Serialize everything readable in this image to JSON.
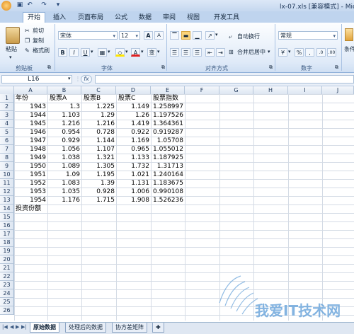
{
  "window": {
    "title": "lx-07.xls [兼容模式] - Microso"
  },
  "ribbon_tabs": [
    "开始",
    "插入",
    "页面布局",
    "公式",
    "数据",
    "审阅",
    "视图",
    "开发工具"
  ],
  "clipboard": {
    "paste": "粘贴",
    "cut": "剪切",
    "copy": "复制",
    "format_painter": "格式刷",
    "group": "剪贴板"
  },
  "font": {
    "name": "宋体",
    "size": "12",
    "grow": "A",
    "shrink": "A",
    "bold": "B",
    "italic": "I",
    "underline": "U",
    "font_color": "A",
    "phonetic": "变",
    "group": "字体"
  },
  "alignment": {
    "wrap": "自动换行",
    "merge": "合并后居中",
    "group": "对齐方式"
  },
  "number": {
    "format": "常规",
    "percent": "%",
    "comma": ",",
    "group": "数字"
  },
  "styles": {
    "label": "条件"
  },
  "formula_bar": {
    "name_box": "L16",
    "fx": "fx",
    "value": ""
  },
  "columns": [
    "A",
    "B",
    "C",
    "D",
    "E",
    "F",
    "G",
    "H",
    "I",
    "J"
  ],
  "rows": [
    "1",
    "2",
    "3",
    "4",
    "5",
    "6",
    "7",
    "8",
    "9",
    "10",
    "11",
    "12",
    "13",
    "14",
    "15",
    "16",
    "17",
    "18",
    "19",
    "20",
    "21",
    "22",
    "23",
    "24",
    "25",
    "26"
  ],
  "table": {
    "headers": [
      "年份",
      "股票A",
      "股票B",
      "股票C",
      "股票指数"
    ],
    "data": [
      [
        "1943",
        "1.3",
        "1.225",
        "1.149",
        "1.258997"
      ],
      [
        "1944",
        "1.103",
        "1.29",
        "1.26",
        "1.197526"
      ],
      [
        "1945",
        "1.216",
        "1.216",
        "1.419",
        "1.364361"
      ],
      [
        "1946",
        "0.954",
        "0.728",
        "0.922",
        "0.919287"
      ],
      [
        "1947",
        "0.929",
        "1.144",
        "1.169",
        "1.05708"
      ],
      [
        "1948",
        "1.056",
        "1.107",
        "0.965",
        "1.055012"
      ],
      [
        "1949",
        "1.038",
        "1.321",
        "1.133",
        "1.187925"
      ],
      [
        "1950",
        "1.089",
        "1.305",
        "1.732",
        "1.31713"
      ],
      [
        "1951",
        "1.09",
        "1.195",
        "1.021",
        "1.240164"
      ],
      [
        "1952",
        "1.083",
        "1.39",
        "1.131",
        "1.183675"
      ],
      [
        "1953",
        "1.035",
        "0.928",
        "1.006",
        "0.990108"
      ],
      [
        "1954",
        "1.176",
        "1.715",
        "1.908",
        "1.526236"
      ]
    ],
    "footer_label": "投资份额"
  },
  "sheet_tabs": [
    "原始数据",
    "处理后的数据",
    "协方差矩阵"
  ],
  "watermark": "我爱IT技术网",
  "colors": {
    "accent": "#c5d8ef",
    "grid": "#d4dbe5",
    "watermark": "#6fa8dc"
  }
}
